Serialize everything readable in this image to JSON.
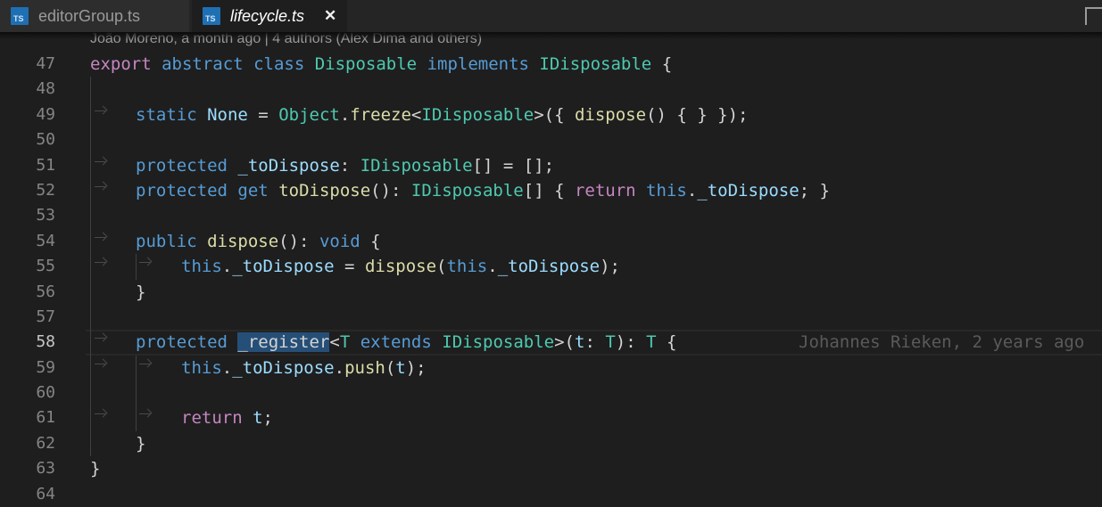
{
  "tabs": [
    {
      "icon": "typescript-file-icon",
      "icon_text": "TS",
      "label": "editorGroup.ts",
      "active": false
    },
    {
      "icon": "typescript-file-icon",
      "icon_text": "TS",
      "label": "lifecycle.ts",
      "active": true,
      "close_glyph": "✕"
    }
  ],
  "codelens": "João Moreno, a month ago | 4 authors (Alex Dima and others)",
  "current_line_blame": "Johannes Rieken, 2 years ago",
  "lines": [
    {
      "n": "47",
      "tokens": [
        [
          "kw2",
          "export"
        ],
        [
          "pl",
          " "
        ],
        [
          "kw",
          "abstract"
        ],
        [
          "pl",
          " "
        ],
        [
          "kw",
          "class"
        ],
        [
          "pl",
          " "
        ],
        [
          "ty",
          "Disposable"
        ],
        [
          "pl",
          " "
        ],
        [
          "kw",
          "implements"
        ],
        [
          "pl",
          " "
        ],
        [
          "ty",
          "IDisposable"
        ],
        [
          "pl",
          " {"
        ]
      ]
    },
    {
      "n": "48",
      "tokens": []
    },
    {
      "n": "49",
      "tokens": [
        [
          "kw",
          "static"
        ],
        [
          "pl",
          " "
        ],
        [
          "var",
          "None"
        ],
        [
          "pl",
          " = "
        ],
        [
          "ty",
          "Object"
        ],
        [
          "pl",
          "."
        ],
        [
          "fn",
          "freeze"
        ],
        [
          "pl",
          "<"
        ],
        [
          "ty",
          "IDisposable"
        ],
        [
          "pl",
          ">({ "
        ],
        [
          "fn",
          "dispose"
        ],
        [
          "pl",
          "() { } });"
        ]
      ]
    },
    {
      "n": "50",
      "tokens": []
    },
    {
      "n": "51",
      "tokens": [
        [
          "kw",
          "protected"
        ],
        [
          "pl",
          " "
        ],
        [
          "var",
          "_toDispose"
        ],
        [
          "pl",
          ": "
        ],
        [
          "ty",
          "IDisposable"
        ],
        [
          "pl",
          "[] = [];"
        ]
      ]
    },
    {
      "n": "52",
      "tokens": [
        [
          "kw",
          "protected"
        ],
        [
          "pl",
          " "
        ],
        [
          "kw",
          "get"
        ],
        [
          "pl",
          " "
        ],
        [
          "fn",
          "toDispose"
        ],
        [
          "pl",
          "(): "
        ],
        [
          "ty",
          "IDisposable"
        ],
        [
          "pl",
          "[] { "
        ],
        [
          "kw2",
          "return"
        ],
        [
          "pl",
          " "
        ],
        [
          "kw",
          "this"
        ],
        [
          "pl",
          "."
        ],
        [
          "var",
          "_toDispose"
        ],
        [
          "pl",
          "; }"
        ]
      ]
    },
    {
      "n": "53",
      "tokens": []
    },
    {
      "n": "54",
      "tokens": [
        [
          "kw",
          "public"
        ],
        [
          "pl",
          " "
        ],
        [
          "fn",
          "dispose"
        ],
        [
          "pl",
          "(): "
        ],
        [
          "kw",
          "void"
        ],
        [
          "pl",
          " {"
        ]
      ]
    },
    {
      "n": "55",
      "tokens": [
        [
          "kw",
          "this"
        ],
        [
          "pl",
          "."
        ],
        [
          "var",
          "_toDispose"
        ],
        [
          "pl",
          " = "
        ],
        [
          "fn",
          "dispose"
        ],
        [
          "pl",
          "("
        ],
        [
          "kw",
          "this"
        ],
        [
          "pl",
          "."
        ],
        [
          "var",
          "_toDispose"
        ],
        [
          "pl",
          ");"
        ]
      ]
    },
    {
      "n": "56",
      "tokens": [
        [
          "pl",
          "}"
        ]
      ]
    },
    {
      "n": "57",
      "tokens": []
    },
    {
      "n": "58",
      "tokens": [
        [
          "kw",
          "protected"
        ],
        [
          "pl",
          " "
        ],
        [
          "sel",
          "_register"
        ],
        [
          "pl",
          "<"
        ],
        [
          "ty",
          "T"
        ],
        [
          "pl",
          " "
        ],
        [
          "kw",
          "extends"
        ],
        [
          "pl",
          " "
        ],
        [
          "ty",
          "IDisposable"
        ],
        [
          "pl",
          ">("
        ],
        [
          "var",
          "t"
        ],
        [
          "pl",
          ": "
        ],
        [
          "ty",
          "T"
        ],
        [
          "pl",
          "): "
        ],
        [
          "ty",
          "T"
        ],
        [
          "pl",
          " {"
        ]
      ]
    },
    {
      "n": "59",
      "tokens": [
        [
          "kw",
          "this"
        ],
        [
          "pl",
          "."
        ],
        [
          "var",
          "_toDispose"
        ],
        [
          "pl",
          "."
        ],
        [
          "fn",
          "push"
        ],
        [
          "pl",
          "("
        ],
        [
          "var",
          "t"
        ],
        [
          "pl",
          ");"
        ]
      ]
    },
    {
      "n": "60",
      "tokens": []
    },
    {
      "n": "61",
      "tokens": [
        [
          "kw2",
          "return"
        ],
        [
          "pl",
          " "
        ],
        [
          "var",
          "t"
        ],
        [
          "pl",
          ";"
        ]
      ]
    },
    {
      "n": "62",
      "tokens": [
        [
          "pl",
          "}"
        ]
      ]
    },
    {
      "n": "63",
      "tokens": [
        [
          "pl",
          "}"
        ]
      ]
    },
    {
      "n": "64",
      "tokens": []
    }
  ],
  "colors": {
    "editor_bg": "#1e1e1e",
    "keyword": "#569cd6",
    "control_keyword": "#c586c0",
    "type": "#4ec9b0",
    "function": "#dcdcaa",
    "variable": "#9cdcfe",
    "selection": "#264f78"
  }
}
